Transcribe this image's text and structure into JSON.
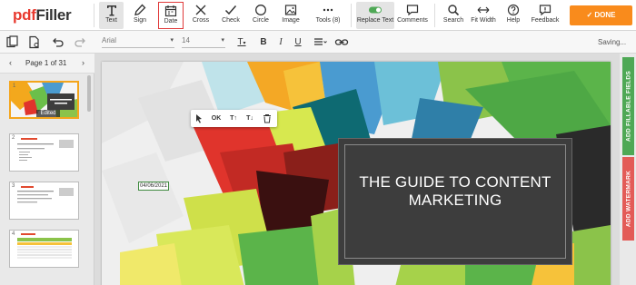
{
  "app": {
    "logo_red": "pdf",
    "logo_rest": "Filler",
    "brand_color": "#e8392f",
    "done_label": "DONE",
    "done_color": "#f98b1c"
  },
  "toolbar": {
    "text": "Text",
    "sign": "Sign",
    "date": "Date",
    "cross": "Cross",
    "check": "Check",
    "circle": "Circle",
    "image": "Image",
    "tools": "Tools (8)",
    "replace_text": "Replace Text",
    "comments": "Comments",
    "search": "Search",
    "fit_width": "Fit Width",
    "help": "Help",
    "feedback": "Feedback"
  },
  "formatbar": {
    "font": "Arial",
    "size": "14",
    "text_color_label": "T",
    "bold_label": "B",
    "italic_label": "I",
    "underline_label": "U",
    "status": "Saving..."
  },
  "pager": {
    "prev": "‹",
    "text": "Page 1 of 31",
    "next": "›"
  },
  "thumbnails": [
    {
      "num": "1",
      "badge": "Edited"
    },
    {
      "num": "2"
    },
    {
      "num": "3"
    },
    {
      "num": "4"
    }
  ],
  "document": {
    "title_line1": "THE GUIDE TO CONTENT",
    "title_line2": "MARKETING",
    "date_value": "04/06/2021"
  },
  "popup": {
    "ok": "OK",
    "t_up": "T↑",
    "t_down": "T↓"
  },
  "right_rail": {
    "fillable": "ADD FILLABLE FIELDS",
    "fillable_color": "#4ea855",
    "watermark": "ADD WATERMARK",
    "watermark_color": "#e35b57"
  }
}
